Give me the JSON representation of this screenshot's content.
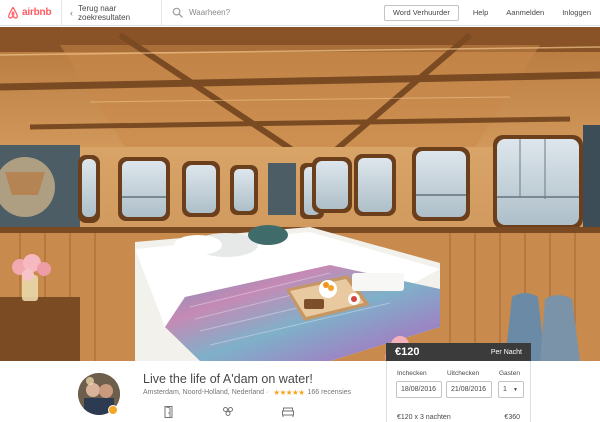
{
  "header": {
    "logo_text": "airbnb",
    "back_label": "Terug naar zoekresultaten",
    "search_placeholder": "Waarheen?",
    "host_button": "Word Verhuurder",
    "help": "Help",
    "signup": "Aanmelden",
    "login": "Inloggen"
  },
  "colors": {
    "brand": "#ff5a5f",
    "star": "#f5a623",
    "price_bar": "#3b3b3b"
  },
  "listing": {
    "title": "Live the life of A'dam on water!",
    "location": "Amsterdam, Noord-Holland, Nederland",
    "separator": "·",
    "rating_stars": 4.5,
    "stars_text": "★★★★★",
    "reviews": "166 recensies",
    "amenity_icons": [
      "door-icon",
      "guests-icon",
      "bed-icon"
    ]
  },
  "booking": {
    "price": "€120",
    "per": "Per Nacht",
    "checkin_label": "Inchecken",
    "checkout_label": "Uitchecken",
    "guests_label": "Gasten",
    "checkin_value": "18/08/2016",
    "checkout_value": "21/08/2016",
    "guests_value": "1",
    "calc_label": "€120 x 3 nachten",
    "calc_total": "€360"
  }
}
